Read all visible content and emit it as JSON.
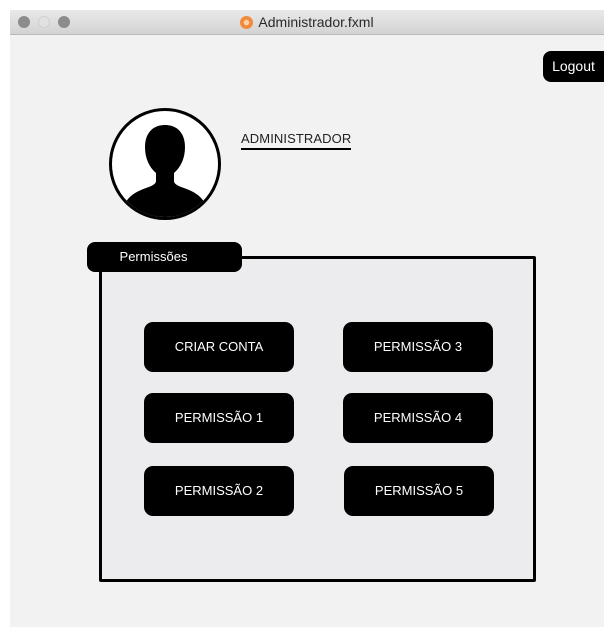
{
  "window": {
    "title": "Administrador.fxml"
  },
  "header": {
    "logout_label": "Logout"
  },
  "profile": {
    "name": "ADMINISTRADOR"
  },
  "permissions": {
    "tab_label": "Permissões",
    "buttons": [
      "CRIAR CONTA",
      "PERMISSÃO 3",
      "PERMISSÃO 1",
      "PERMISSÃO 4",
      "PERMISSÃO 2",
      "PERMISSÃO 5"
    ]
  }
}
